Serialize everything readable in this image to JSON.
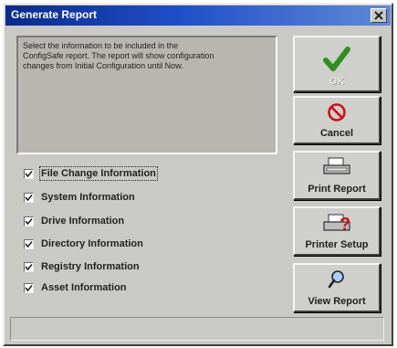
{
  "window": {
    "title": "Generate Report"
  },
  "description": {
    "lines": [
      "Select the information to be included in the",
      "ConfigSafe report.  The report will show configuration",
      "changes from Initial Configuration until Now."
    ]
  },
  "options": [
    {
      "label": "File Change Information",
      "checked": true
    },
    {
      "label": "System Information",
      "checked": true
    },
    {
      "label": "Drive Information",
      "checked": true
    },
    {
      "label": "Directory Information",
      "checked": true
    },
    {
      "label": "Registry Information",
      "checked": true
    },
    {
      "label": "Asset Information",
      "checked": true
    }
  ],
  "buttons": {
    "ok": {
      "label": "OK",
      "icon": "checkmark-icon",
      "enabled": false
    },
    "cancel": {
      "label": "Cancel",
      "icon": "cancel-icon"
    },
    "print_report": {
      "label": "Print Report",
      "icon": "printer-icon"
    },
    "printer_setup": {
      "label": "Printer Setup",
      "icon": "printer-setup-icon"
    },
    "view_report": {
      "label": "View Report",
      "icon": "magnifier-icon"
    }
  },
  "status_bar": {
    "text": ""
  },
  "colors": {
    "title_bar_start": "#0a2a8a",
    "title_bar_end": "#5f8ad8",
    "ok_check": "#2f8f1f",
    "cancel_red": "#cc1111"
  }
}
